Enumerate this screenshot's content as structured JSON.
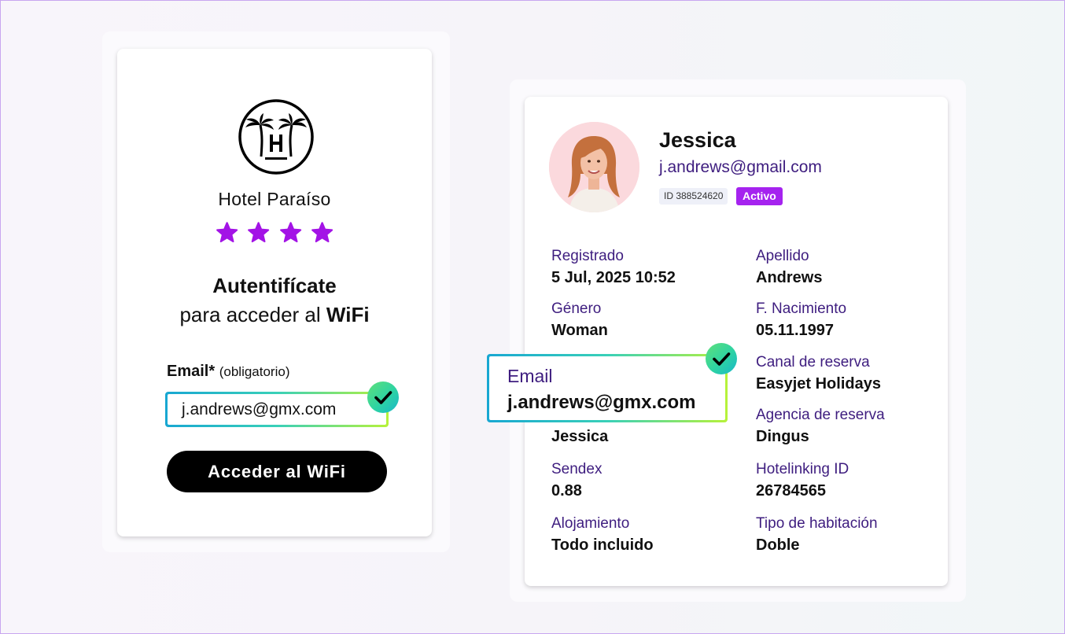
{
  "login": {
    "hotel_name": "Hotel Paraíso",
    "stars": 4,
    "logo_icon": "palm-trees-hotel-logo-icon",
    "star_icon": "star-icon",
    "star_color": "#a313e6",
    "title": "Autentifícate",
    "subtitle_prefix": "para acceder al",
    "subtitle_bold": "WiFi",
    "email_label": "Email*",
    "email_label_note": "(obligatorio)",
    "email_value": "j.andrews@gmx.com",
    "check_icon": "check-icon",
    "button_label": "Acceder al WiFi"
  },
  "profile": {
    "name": "Jessica",
    "email": "j.andrews@gmail.com",
    "id_badge": "ID 388524620",
    "status": "Activo",
    "status_color": "#a523ef",
    "label_color": "#3e1d7f",
    "fields_left": [
      {
        "label": "Registrado",
        "value": "5 Jul, 2025 10:52"
      },
      {
        "label": "Género",
        "value": "Woman"
      },
      {
        "label": "",
        "value": "Jessica"
      },
      {
        "label": "Sendex",
        "value": "0.88"
      },
      {
        "label": "Alojamiento",
        "value": "Todo incluido"
      }
    ],
    "fields_right": [
      {
        "label": "Apellido",
        "value": "Andrews"
      },
      {
        "label": "F. Nacimiento",
        "value": "05.11.1997"
      },
      {
        "label": "Canal de reserva",
        "value": "Easyjet Holidays"
      },
      {
        "label": "Agencia de reserva",
        "value": "Dingus"
      },
      {
        "label": "Hotelinking ID",
        "value": "26784565"
      },
      {
        "label": "Tipo de habitación",
        "value": "Doble"
      }
    ],
    "email_popup": {
      "label": "Email",
      "value": "j.andrews@gmx.com"
    }
  }
}
